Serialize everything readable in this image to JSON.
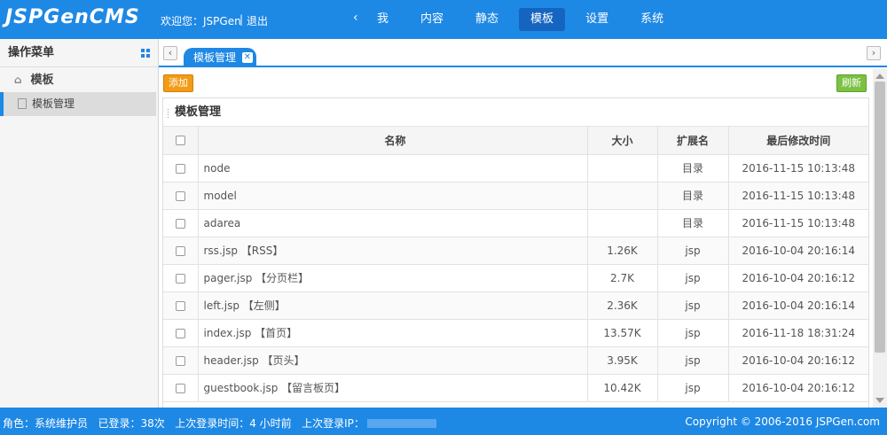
{
  "header": {
    "logo": "JSPGenCMS",
    "welcome": "欢迎您：JSPGen",
    "separator": "|",
    "logout": "退出",
    "nav_prev": "‹",
    "nav": [
      {
        "label": "我",
        "active": false
      },
      {
        "label": "内容",
        "active": false
      },
      {
        "label": "静态",
        "active": false
      },
      {
        "label": "模板",
        "active": true
      },
      {
        "label": "设置",
        "active": false
      },
      {
        "label": "系统",
        "active": false
      }
    ],
    "nav_next": "›"
  },
  "sidebar": {
    "title": "操作菜单",
    "group_label": "模板",
    "item_label": "模板管理"
  },
  "tabs": {
    "prev": "‹",
    "next": "›",
    "active_tab": "模板管理",
    "close": "✕"
  },
  "toolbar": {
    "add_label": "添加",
    "refresh_label": "刷新"
  },
  "panel": {
    "title": "模板管理",
    "columns": [
      "名称",
      "大小",
      "扩展名",
      "最后修改时间"
    ],
    "rows": [
      {
        "name": "node",
        "size": "",
        "ext": "目录",
        "time": "2016-11-15 10:13:48"
      },
      {
        "name": "model",
        "size": "",
        "ext": "目录",
        "time": "2016-11-15 10:13:48"
      },
      {
        "name": "adarea",
        "size": "",
        "ext": "目录",
        "time": "2016-11-15 10:13:48"
      },
      {
        "name": "rss.jsp 【RSS】",
        "size": "1.26K",
        "ext": "jsp",
        "time": "2016-10-04 20:16:14"
      },
      {
        "name": "pager.jsp 【分页栏】",
        "size": "2.7K",
        "ext": "jsp",
        "time": "2016-10-04 20:16:12"
      },
      {
        "name": "left.jsp 【左侧】",
        "size": "2.36K",
        "ext": "jsp",
        "time": "2016-10-04 20:16:14"
      },
      {
        "name": "index.jsp 【首页】",
        "size": "13.57K",
        "ext": "jsp",
        "time": "2016-11-18 18:31:24"
      },
      {
        "name": "header.jsp 【页头】",
        "size": "3.95K",
        "ext": "jsp",
        "time": "2016-10-04 20:16:12"
      },
      {
        "name": "guestbook.jsp 【留言板页】",
        "size": "10.42K",
        "ext": "jsp",
        "time": "2016-10-04 20:16:12"
      }
    ]
  },
  "footer": {
    "role": "角色：系统维护员",
    "logins": "已登录：38次",
    "last_login_time": "上次登录时间：4 小时前",
    "last_login_ip": "上次登录IP：",
    "copyright": "Copyright © 2006-2016 JSPGen.com"
  },
  "colors": {
    "primary": "#1e88e5",
    "nav_active": "#1565c0",
    "add_button": "#f29b16",
    "refresh_button": "#7cc142"
  }
}
